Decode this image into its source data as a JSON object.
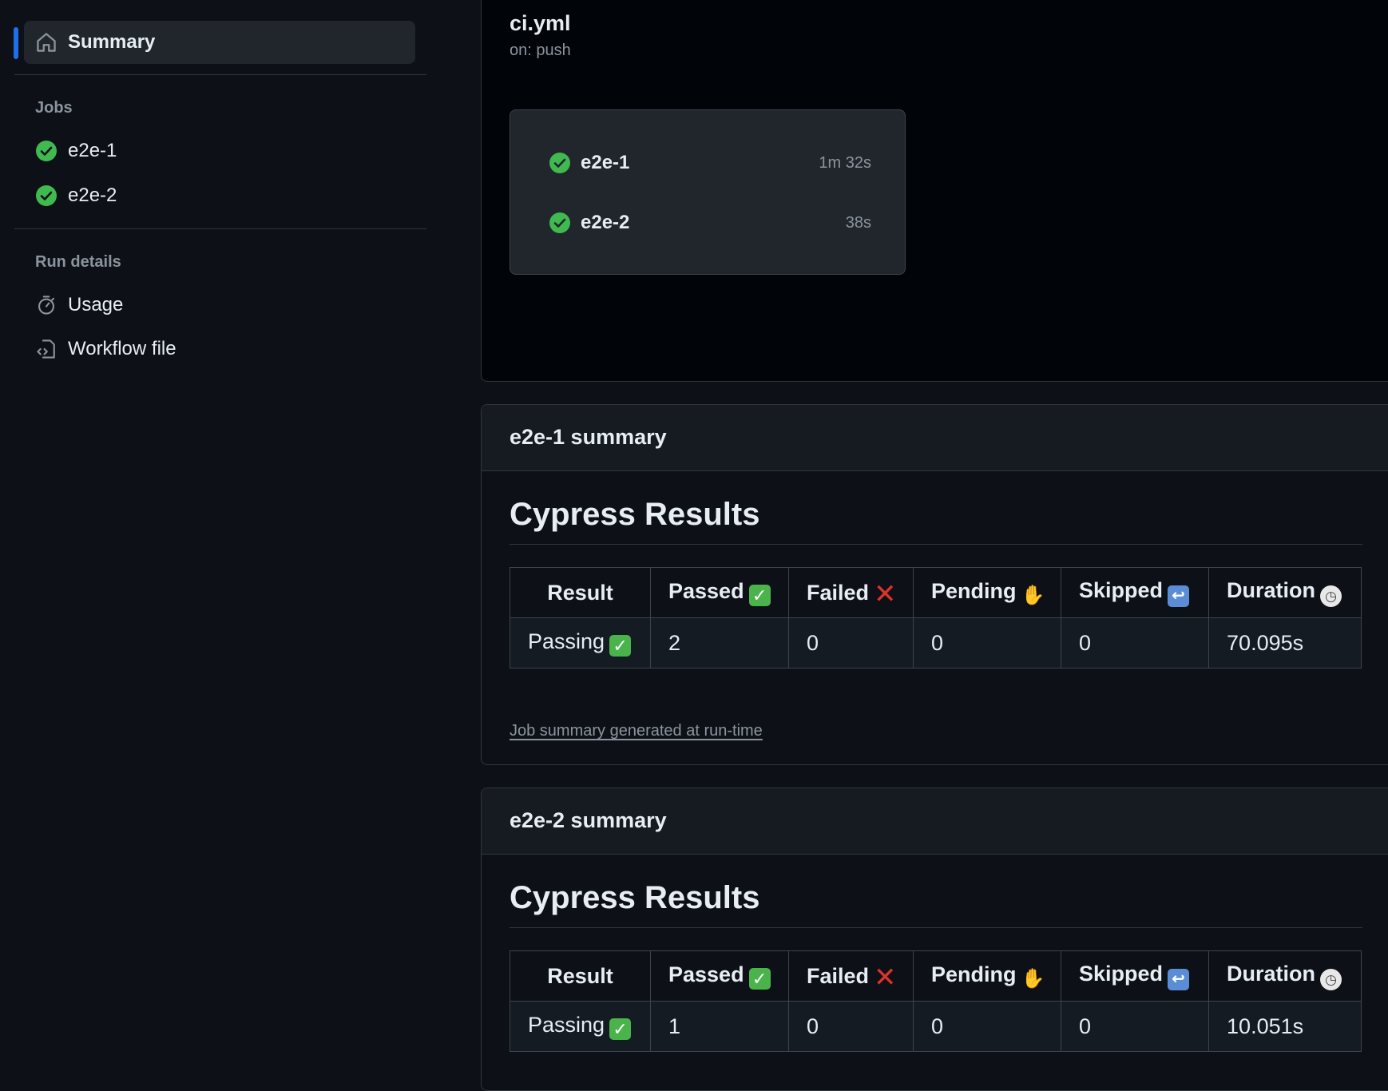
{
  "sidebar": {
    "summary_label": "Summary",
    "jobs_heading": "Jobs",
    "jobs": [
      {
        "label": "e2e-1"
      },
      {
        "label": "e2e-2"
      }
    ],
    "run_details_heading": "Run details",
    "usage_label": "Usage",
    "workflow_file_label": "Workflow file"
  },
  "workflow": {
    "title": "ci.yml",
    "trigger": "on: push",
    "jobs": [
      {
        "name": "e2e-1",
        "duration": "1m 32s",
        "status": "success"
      },
      {
        "name": "e2e-2",
        "duration": "38s",
        "status": "success"
      }
    ]
  },
  "summaries": [
    {
      "header": "e2e-1 summary",
      "title": "Cypress Results",
      "columns": [
        "Result",
        "Passed",
        "Failed",
        "Pending",
        "Skipped",
        "Duration"
      ],
      "row": [
        "Passing",
        "2",
        "0",
        "0",
        "0",
        "70.095s"
      ],
      "footnote": "Job summary generated at run-time"
    },
    {
      "header": "e2e-2 summary",
      "title": "Cypress Results",
      "columns": [
        "Result",
        "Passed",
        "Failed",
        "Pending",
        "Skipped",
        "Duration"
      ],
      "row": [
        "Passing",
        "1",
        "0",
        "0",
        "0",
        "10.051s"
      ]
    }
  ],
  "colors": {
    "accent": "#1f6feb",
    "success": "#3fb950",
    "background": "#0d1117"
  }
}
